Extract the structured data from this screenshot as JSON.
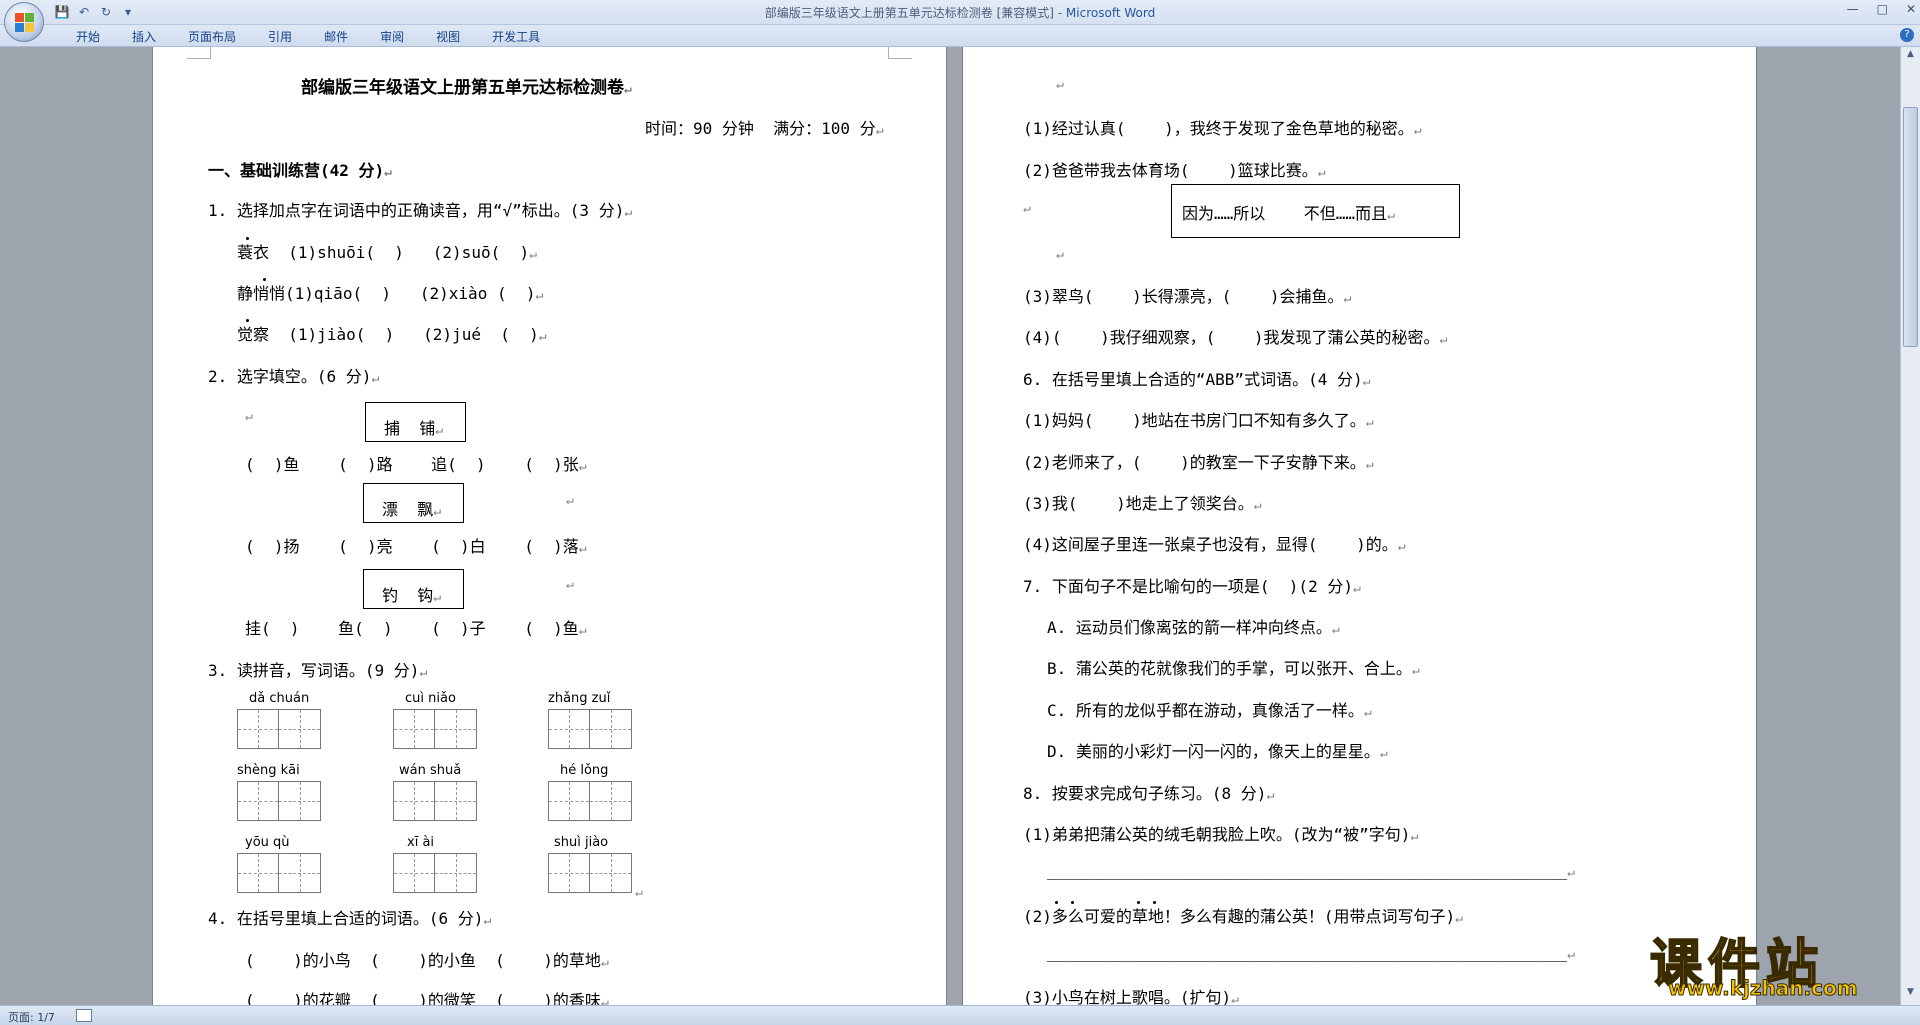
{
  "window": {
    "title": "部编版三年级语文上册第五单元达标检测卷 [兼容模式] - ",
    "app": "Microsoft Word"
  },
  "ribbon_tabs": [
    "开始",
    "插入",
    "页面布局",
    "引用",
    "邮件",
    "审阅",
    "视图",
    "开发工具"
  ],
  "status": {
    "page": "页面: 1/7"
  },
  "watermark": {
    "text": "课件站",
    "url": "www.kjzhan.com"
  },
  "left": {
    "title": "部编版三年级语文上册第五单元达标检测卷",
    "meta": "时间：90 分钟  满分：100 分",
    "sec1": "一、基础训练营(42 分)",
    "q1": "1. 选择加点字在词语中的正确读音，用“√”标出。(3 分)",
    "q1_rows": [
      {
        "word": "蓑衣",
        "a": "(1)shuōi(  )",
        "b": "(2)suō(  )"
      },
      {
        "word": "静悄悄",
        "a": "(1)qiāo(  )",
        "b": "(2)xiào (  )"
      },
      {
        "word": "觉察",
        "a": "(1)jiào(  )",
        "b": "(2)jué  (  )"
      }
    ],
    "q2": "2. 选字填空。(6 分)",
    "q2_boxes": [
      "捕  铺",
      "漂  飘",
      "钓  钩"
    ],
    "q2_rows": [
      "(  )鱼    (  )路    追(  )    (  )张",
      "(  )扬    (  )亮    (  )白    (  )落",
      "挂(  )    鱼(  )    (  )子    (  )鱼"
    ],
    "q3": "3. 读拼音，写词语。(9 分)",
    "pinyin": [
      [
        "dǎ   chuán",
        "cuì   niǎo",
        "zhǎng   zuǐ"
      ],
      [
        "shèng   kāi",
        "wán   shuǎ",
        "hé   lǒng"
      ],
      [
        "yōu   qù",
        "xī   ài",
        "shuì   jiào"
      ]
    ],
    "q4": "4. 在括号里填上合适的词语。(6 分)",
    "q4_rows": [
      "(    )的小鸟  (    )的小鱼  (    )的草地",
      "(    )的花瓣  (    )的微笑  (    )的香味"
    ]
  },
  "right": {
    "lines": [
      "(1)经过认真(    )，我终于发现了金色草地的秘密。",
      "(2)爸爸带我去体育场(    )篮球比赛。",
      "(3)翠鸟(    )长得漂亮，(    )会捕鱼。",
      "(4)(    )我仔细观察，(    )我发现了蒲公英的秘密。",
      "6. 在括号里填上合适的“ABB”式词语。(4 分)",
      "(1)妈妈(    )地站在书房门口不知有多久了。",
      "(2)老师来了，(    )的教室一下子安静下来。",
      "(3)我(    )地走上了领奖台。",
      "(4)这间屋子里连一张桌子也没有，显得(    )的。",
      "7. 下面句子不是比喻句的一项是(  )(2 分)",
      "A. 运动员们像离弦的箭一样冲向终点。",
      "B. 蒲公英的花就像我们的手掌，可以张开、合上。",
      "C. 所有的龙似乎都在游动，真像活了一样。",
      "D. 美丽的小彩灯一闪一闪的，像天上的星星。",
      "8. 按要求完成句子练习。(8 分)",
      "(1)弟弟把蒲公英的绒毛朝我脸上吹。(改为“被”字句)",
      "(2)多么可爱的草地！多么有趣的蒲公英！(用带点词写句子)",
      "(3)小鸟在树上歌唱。(扩句)"
    ],
    "conjunction_box": "因为……所以    不但……而且",
    "answer_line": "______________________________________________________"
  }
}
